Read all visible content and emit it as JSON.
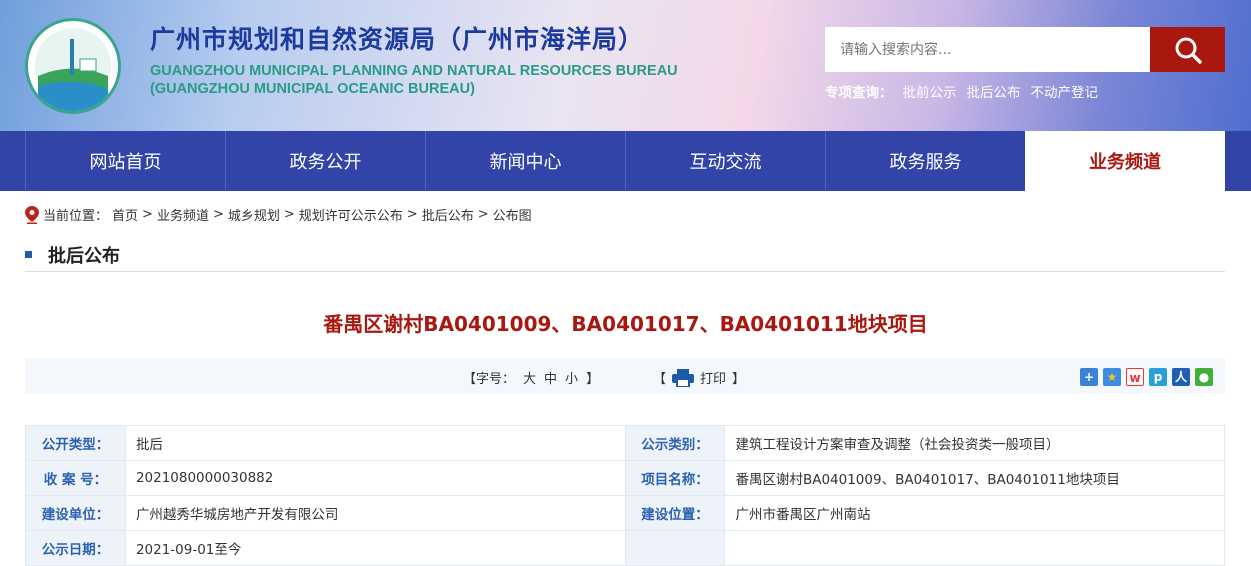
{
  "header": {
    "title_cn": "广州市规划和自然资源局（广州市海洋局）",
    "title_en_1": "GUANGZHOU MUNICIPAL PLANNING AND NATURAL RESOURCES BUREAU",
    "title_en_2": "(GUANGZHOU MUNICIPAL OCEANIC BUREAU)",
    "logo_text": "广州市规划和自然资源局",
    "search_placeholder": "请输入搜索内容...",
    "quick_label": "专项查询：",
    "quick_links": [
      "批前公示",
      "批后公布",
      "不动产登记"
    ]
  },
  "nav": [
    "网站首页",
    "政务公开",
    "新闻中心",
    "互动交流",
    "政务服务",
    "业务频道"
  ],
  "breadcrumb": {
    "label": "当前位置：",
    "items": [
      "首页",
      "业务频道",
      "城乡规划",
      "规划许可公示公布",
      "批后公布",
      "公布图"
    ],
    "sep": ">"
  },
  "section_title": "批后公布",
  "article": {
    "title": "番禺区谢村BA0401009、BA0401017、BA0401011地块项目"
  },
  "toolbar": {
    "font_open": "【字号：",
    "big": "大",
    "mid": "中",
    "small": "小",
    "font_close": "】",
    "print_open": "【",
    "print": "打印",
    "print_close": "】"
  },
  "info": [
    {
      "k1": "公开类型：",
      "v1": "批后",
      "k2": "公示类别：",
      "v2": "建筑工程设计方案审查及调整（社会投资类一般项目）"
    },
    {
      "k1": "收 案 号：",
      "v1": "2021080000030882",
      "k2": "项目名称：",
      "v2": "番禺区谢村BA0401009、BA0401017、BA0401011地块项目"
    },
    {
      "k1": "建设单位：",
      "v1": "广州越秀华城房地产开发有限公司",
      "k2": "建设位置：",
      "v2": "广州市番禺区广州南站"
    },
    {
      "k1": "公示日期：",
      "v1": "2021-09-01至今",
      "k2": "",
      "v2": ""
    }
  ],
  "colors": {
    "nav": "#3344a8",
    "accent": "#a9180f",
    "label": "#2d62b0"
  }
}
